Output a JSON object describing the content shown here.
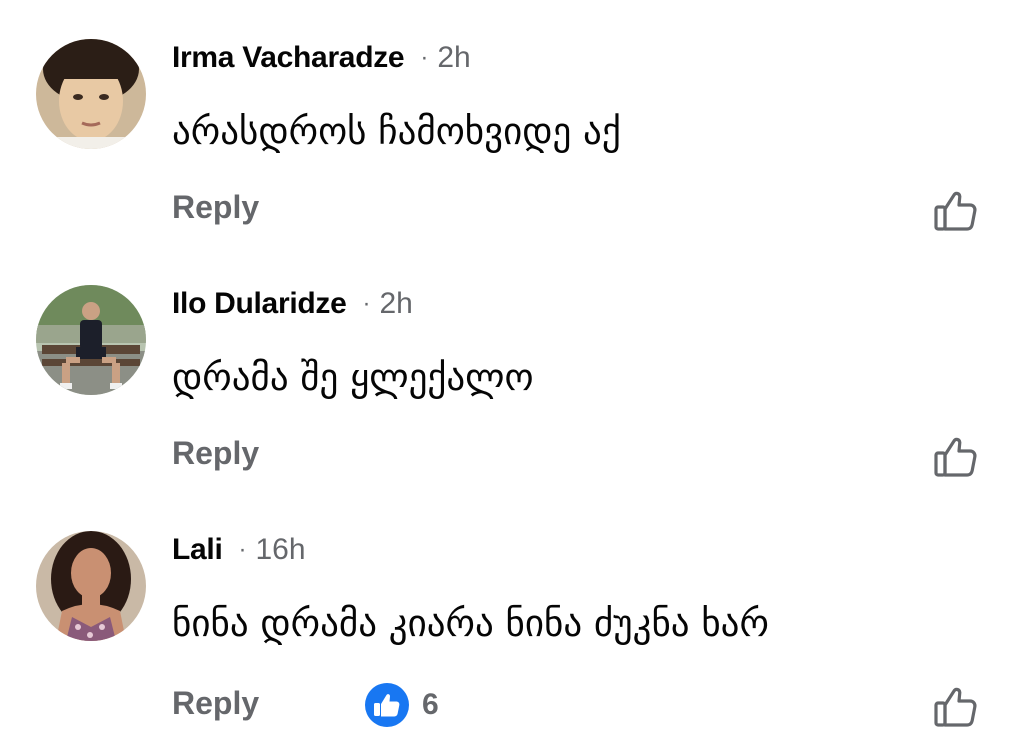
{
  "comments": [
    {
      "author": "Irma Vacharadze",
      "separator": "·",
      "time": "2h",
      "text": "არასდროს ჩამოხვიდე აქ",
      "reply_label": "Reply"
    },
    {
      "author": "Ilo Dularidze",
      "separator": "·",
      "time": "2h",
      "text": "დრამა შე ყლექალო",
      "reply_label": "Reply"
    },
    {
      "author": "Lali",
      "separator": "·",
      "time": "16h",
      "text": "ნინა დრამა კიარა ნინა ძუკნა ხარ",
      "reply_label": "Reply",
      "reaction_count": "6"
    }
  ],
  "icons": {
    "like": "thumbs-up-outline-icon",
    "reaction": "like-reaction-icon"
  },
  "colors": {
    "text_primary": "#050505",
    "text_secondary": "#65676b",
    "like_blue": "#1877f2"
  }
}
